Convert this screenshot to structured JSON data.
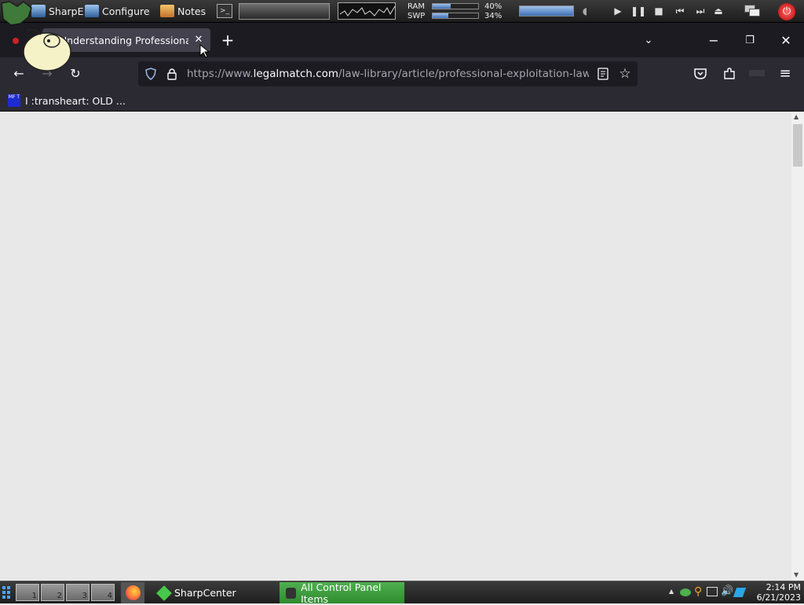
{
  "topbar": {
    "apps": [
      {
        "label": "SharpE",
        "icon": "monitor-icon"
      },
      {
        "label": "Configure",
        "icon": "monitor-icon"
      },
      {
        "label": "Notes",
        "icon": "notes-icon"
      }
    ],
    "ram_label": "RAM",
    "swp_label": "SWP",
    "ram_percent": "40%",
    "swp_percent": "34%",
    "ram_fraction": 0.4,
    "swp_fraction": 0.34,
    "volume_fraction": 1.0
  },
  "browser": {
    "tab_title": "Understanding Professional Exploitation Laws",
    "url_domain_prefix": "https://www.",
    "url_domain": "legalmatch.com",
    "url_path": "/law-library/article/professional-exploitation-laws",
    "bookmark_label": "I :transheart: OLD ...",
    "bookmark_favicon": "MF T"
  },
  "taskbar": {
    "workspaces": [
      "1",
      "2",
      "3",
      "4"
    ],
    "tasks": [
      {
        "label": "SharpCenter",
        "active": false
      },
      {
        "label": "All Control Panel Items",
        "active": true
      }
    ],
    "clock_time": "2:14 PM",
    "clock_date": "6/21/2023"
  },
  "colors": {
    "chrome_dark": "#1c1b22",
    "chrome_mid": "#2b2a33",
    "active_task": "#3d9b3d",
    "content_bg": "#e8e8e8"
  }
}
